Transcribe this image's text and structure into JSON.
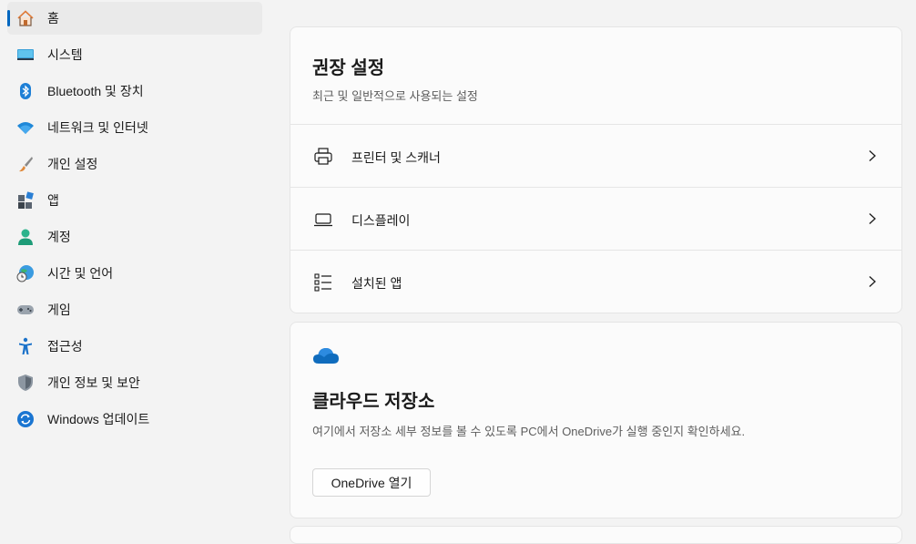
{
  "sidebar": {
    "items": [
      {
        "label": "홈",
        "icon": "home-icon",
        "active": true
      },
      {
        "label": "시스템",
        "icon": "monitor-icon"
      },
      {
        "label": "Bluetooth 및 장치",
        "icon": "bluetooth-icon"
      },
      {
        "label": "네트워크 및 인터넷",
        "icon": "wifi-icon"
      },
      {
        "label": "개인 설정",
        "icon": "brush-icon"
      },
      {
        "label": "앱",
        "icon": "apps-icon"
      },
      {
        "label": "계정",
        "icon": "person-icon"
      },
      {
        "label": "시간 및 언어",
        "icon": "globe-clock-icon"
      },
      {
        "label": "게임",
        "icon": "gamepad-icon"
      },
      {
        "label": "접근성",
        "icon": "accessibility-icon"
      },
      {
        "label": "개인 정보 및 보안",
        "icon": "shield-icon"
      },
      {
        "label": "Windows 업데이트",
        "icon": "update-icon"
      }
    ]
  },
  "recommended": {
    "title": "권장 설정",
    "subtitle": "최근 및 일반적으로 사용되는 설정",
    "rows": [
      {
        "label": "프린터 및 스캐너",
        "icon": "printer-icon"
      },
      {
        "label": "디스플레이",
        "icon": "laptop-icon"
      },
      {
        "label": "설치된 앱",
        "icon": "list-icon"
      }
    ]
  },
  "cloud": {
    "icon": "cloud-icon",
    "title": "클라우드 저장소",
    "description": "여기에서 저장소 세부 정보를 볼 수 있도록 PC에서 OneDrive가 실행 중인지 확인하세요.",
    "button_label": "OneDrive 열기"
  },
  "colors": {
    "accent": "#0067c0",
    "onedrive": "#0f6cbd"
  }
}
